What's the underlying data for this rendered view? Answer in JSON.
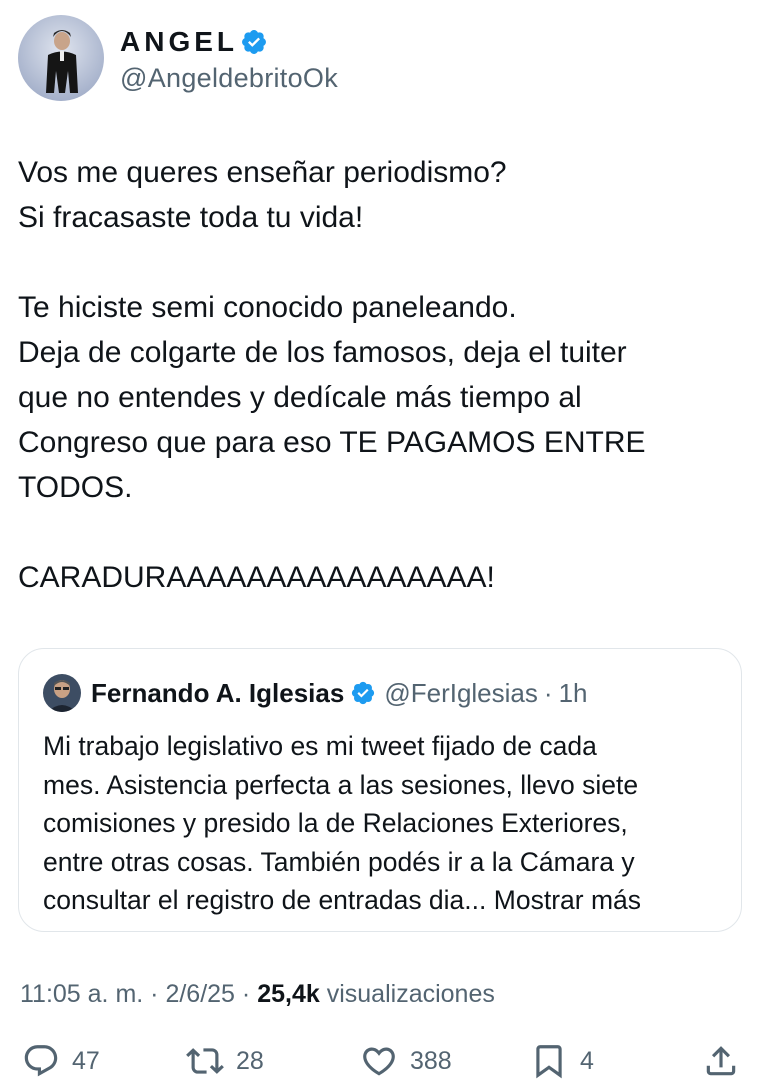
{
  "author": {
    "display_name": "ANGEL",
    "handle": "@AngeldebritoOk",
    "verified": true
  },
  "tweet": {
    "paragraphs": [
      [
        "Vos me queres enseñar periodismo?",
        "Si fracasaste toda tu vida!"
      ],
      [
        "Te hiciste semi conocido paneleando.",
        "Deja de colgarte de los famosos, deja el tuiter",
        "que no entendes y dedícale más tiempo al",
        "Congreso que para eso TE PAGAMOS ENTRE",
        "TODOS."
      ],
      [
        "CARADURAAAAAAAAAAAAAAAA!"
      ]
    ]
  },
  "quote": {
    "display_name": "Fernando A. Iglesias",
    "handle": "@FerIglesias",
    "separator": "·",
    "time": "1h",
    "lines": [
      "Mi trabajo legislativo es mi tweet fijado de cada",
      "mes. Asistencia perfecta a las sesiones, llevo siete",
      "comisiones y presido la de Relaciones Exteriores,",
      "entre otras cosas. También podés ir a la Cámara y",
      "consultar el registro de entradas dia..."
    ],
    "show_more": "Mostrar más"
  },
  "meta": {
    "time": "11:05 a. m.",
    "sep1": "·",
    "date": "2/6/25",
    "sep2": "·",
    "views_count": "25,4k",
    "views_label": "visualizaciones"
  },
  "actions": {
    "replies": "47",
    "retweets": "28",
    "likes": "388",
    "bookmarks": "4"
  },
  "colors": {
    "verified_blue": "#1d9bf0",
    "text": "#0f1419",
    "secondary": "#536471",
    "border": "#e1e6ea"
  },
  "icons": [
    "verified-badge-icon",
    "reply-icon",
    "retweet-icon",
    "like-icon",
    "bookmark-icon",
    "share-icon"
  ]
}
